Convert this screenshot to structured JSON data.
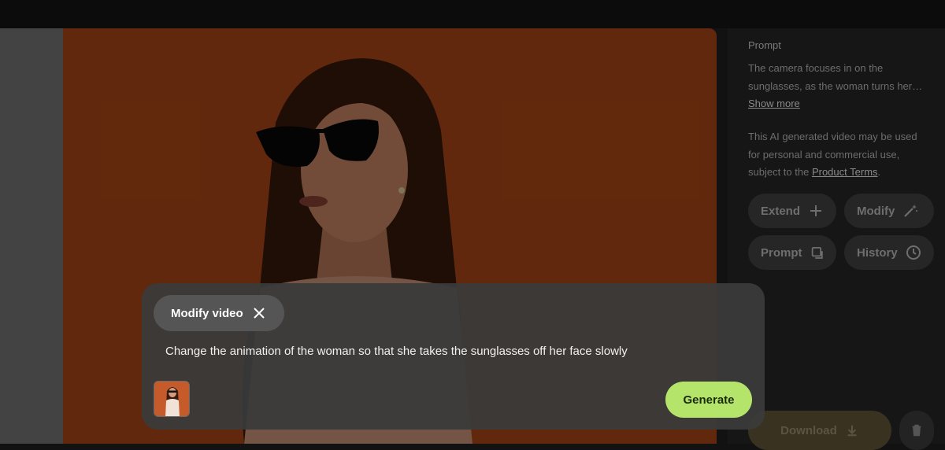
{
  "sidebar": {
    "prompt_heading": "Prompt",
    "prompt_line1": "The camera focuses in on the",
    "prompt_line2": "sunglasses, as the woman turns her…",
    "show_more": "Show more",
    "usage_line1": "This AI generated video may be used",
    "usage_line2": "for personal and commercial use,",
    "usage_line3_prefix": "subject to the ",
    "usage_link": "Product Terms",
    "usage_line3_suffix": ".",
    "buttons": {
      "extend": "Extend",
      "modify": "Modify",
      "prompt": "Prompt",
      "history": "History"
    },
    "download": "Download"
  },
  "modify_panel": {
    "chip_label": "Modify video",
    "prompt_text": "Change the animation of the woman so that she takes the sunglasses off her face slowly",
    "generate_label": "Generate"
  },
  "icons": {
    "extend": "plus-icon",
    "modify": "magic-wand-icon",
    "prompt": "copy-icon",
    "history": "clock-icon",
    "download": "download-icon",
    "delete": "trash-icon",
    "close": "close-icon"
  },
  "colors": {
    "video_background": "#b24a18",
    "generate_button": "#b4e46a",
    "download_button": "#3a3221"
  }
}
